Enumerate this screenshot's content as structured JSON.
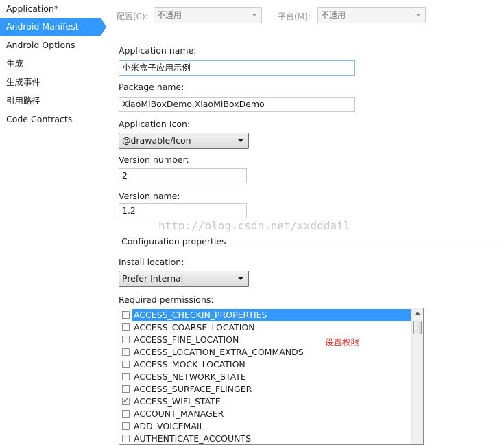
{
  "sidebar": {
    "items": [
      {
        "label": "Application*"
      },
      {
        "label": "Android Manifest",
        "active": true
      },
      {
        "label": "Android Options"
      },
      {
        "label": "生成"
      },
      {
        "label": "生成事件"
      },
      {
        "label": "引用路径"
      },
      {
        "label": "Code Contracts"
      }
    ]
  },
  "config_bar": {
    "config_label": "配置(C):",
    "config_value": "不适用",
    "platform_label": "平台(M):",
    "platform_value": "不适用"
  },
  "form": {
    "app_name_label": "Application name:",
    "app_name_value": "小米盒子应用示例",
    "package_name_label": "Package name:",
    "package_name_value": "XiaoMiBoxDemo.XiaoMiBoxDemo",
    "app_icon_label": "Application Icon:",
    "app_icon_value": "@drawable/Icon",
    "version_number_label": "Version number:",
    "version_number_value": "2",
    "version_name_label": "Version name:",
    "version_name_value": "1.2",
    "config_group_label": "Configuration properties",
    "install_location_label": "Install location:",
    "install_location_value": "Prefer Internal",
    "permissions_label": "Required permissions:"
  },
  "permissions": [
    {
      "name": "ACCESS_CHECKIN_PROPERTIES",
      "checked": false,
      "selected": true
    },
    {
      "name": "ACCESS_COARSE_LOCATION",
      "checked": false
    },
    {
      "name": "ACCESS_FINE_LOCATION",
      "checked": false
    },
    {
      "name": "ACCESS_LOCATION_EXTRA_COMMANDS",
      "checked": false
    },
    {
      "name": "ACCESS_MOCK_LOCATION",
      "checked": false
    },
    {
      "name": "ACCESS_NETWORK_STATE",
      "checked": false
    },
    {
      "name": "ACCESS_SURFACE_FLINGER",
      "checked": false
    },
    {
      "name": "ACCESS_WIFI_STATE",
      "checked": true
    },
    {
      "name": "ACCOUNT_MANAGER",
      "checked": false
    },
    {
      "name": "ADD_VOICEMAIL",
      "checked": false
    },
    {
      "name": "AUTHENTICATE_ACCOUNTS",
      "checked": false
    }
  ],
  "annotation": "设置权限",
  "watermark": "http://blog.csdn.net/xxdddail",
  "colors": {
    "selection": "#3399ff",
    "annotation": "#e02020"
  }
}
